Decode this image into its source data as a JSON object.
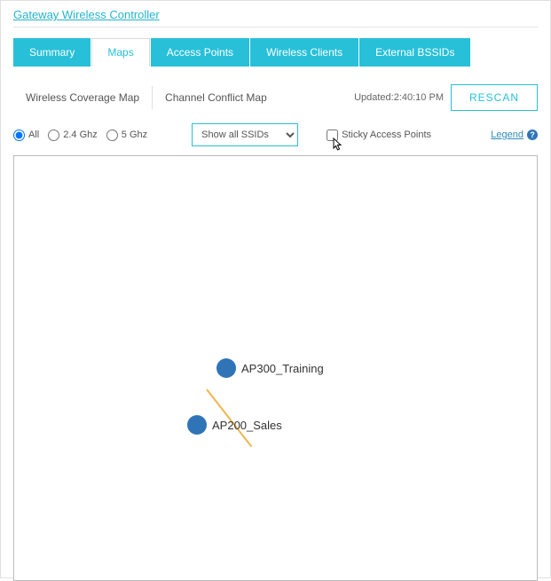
{
  "header": {
    "title": "Gateway Wireless Controller"
  },
  "tabs": {
    "summary": "Summary",
    "maps": "Maps",
    "access_points": "Access Points",
    "wireless_clients": "Wireless Clients",
    "external_bssids": "External BSSIDs"
  },
  "subtabs": {
    "coverage": "Wireless Coverage Map",
    "conflict": "Channel Conflict Map"
  },
  "status": {
    "updated_label": "Updated:",
    "updated_time": "2:40:10 PM",
    "rescan": "RESCAN"
  },
  "filters": {
    "all": "All",
    "ghz24": "2.4 Ghz",
    "ghz5": "5 Ghz",
    "ssid_selected": "Show all SSIDs",
    "sticky": "Sticky Access Points"
  },
  "legend": {
    "label": "Legend",
    "help": "?"
  },
  "nodes": {
    "n1": "AP300_Training",
    "n2": "AP200_Sales"
  }
}
